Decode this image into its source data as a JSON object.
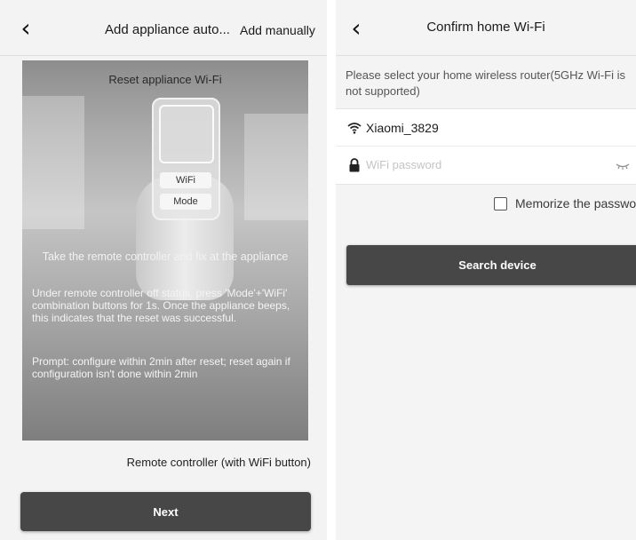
{
  "left": {
    "header": {
      "title": "Add appliance auto...",
      "action_label": "Add manually"
    },
    "illustration": {
      "title": "Reset appliance Wi-Fi",
      "buttons": [
        "WiFi",
        "Mode"
      ],
      "instruction_1": "Take the remote controller and fix at the appliance",
      "instruction_2": "Under remote controller off status, press 'Mode'+'WiFi' combination buttons for 1s. Once the appliance beeps, this indicates that the reset was successful.",
      "instruction_3": "Prompt: configure within 2min after reset; reset again if configuration isn't done within 2min"
    },
    "caption": "Remote controller (with WiFi button)",
    "next_label": "Next"
  },
  "right": {
    "header": {
      "title": "Confirm home Wi-Fi"
    },
    "prompt": "Please select your home wireless router(5GHz Wi-Fi is not supported)",
    "wifi": {
      "ssid": "Xiaomi_3829",
      "password_value": "",
      "password_placeholder": "WiFi password"
    },
    "memorize_label": "Memorize the password",
    "search_label": "Search device"
  },
  "icons": {
    "back": "chevron-left-icon",
    "wifi": "wifi-icon",
    "lock": "lock-icon",
    "visibility": "eye-closed-icon"
  }
}
